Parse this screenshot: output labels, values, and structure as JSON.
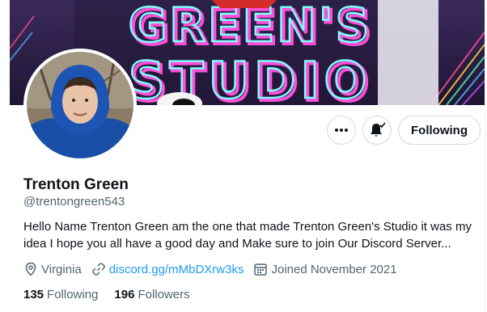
{
  "banner": {
    "line1": "GREEN'S",
    "line2": "STUDIO"
  },
  "profile": {
    "display_name": "Trenton Green",
    "handle": "@trentongreen543",
    "bio": "Hello Name Trenton Green am the one that made Trenton Green's Studio it was my idea I hope you all have a good day and Make sure to join Our Discord Server...",
    "location": "Virginia",
    "website": "discord.gg/mMbDXrw3ks",
    "joined": "Joined November 2021"
  },
  "actions": {
    "following_label": "Following"
  },
  "stats": {
    "following_count": "135",
    "following_label": "Following",
    "followers_count": "196",
    "followers_label": "Followers"
  },
  "icons": {
    "more": "more-icon",
    "notifications": "bell-icon",
    "location": "location-pin-icon",
    "link": "link-icon",
    "calendar": "calendar-icon"
  },
  "colors": {
    "link": "#1d9bf0",
    "secondary_text": "#536471",
    "border": "#cfd9de"
  }
}
